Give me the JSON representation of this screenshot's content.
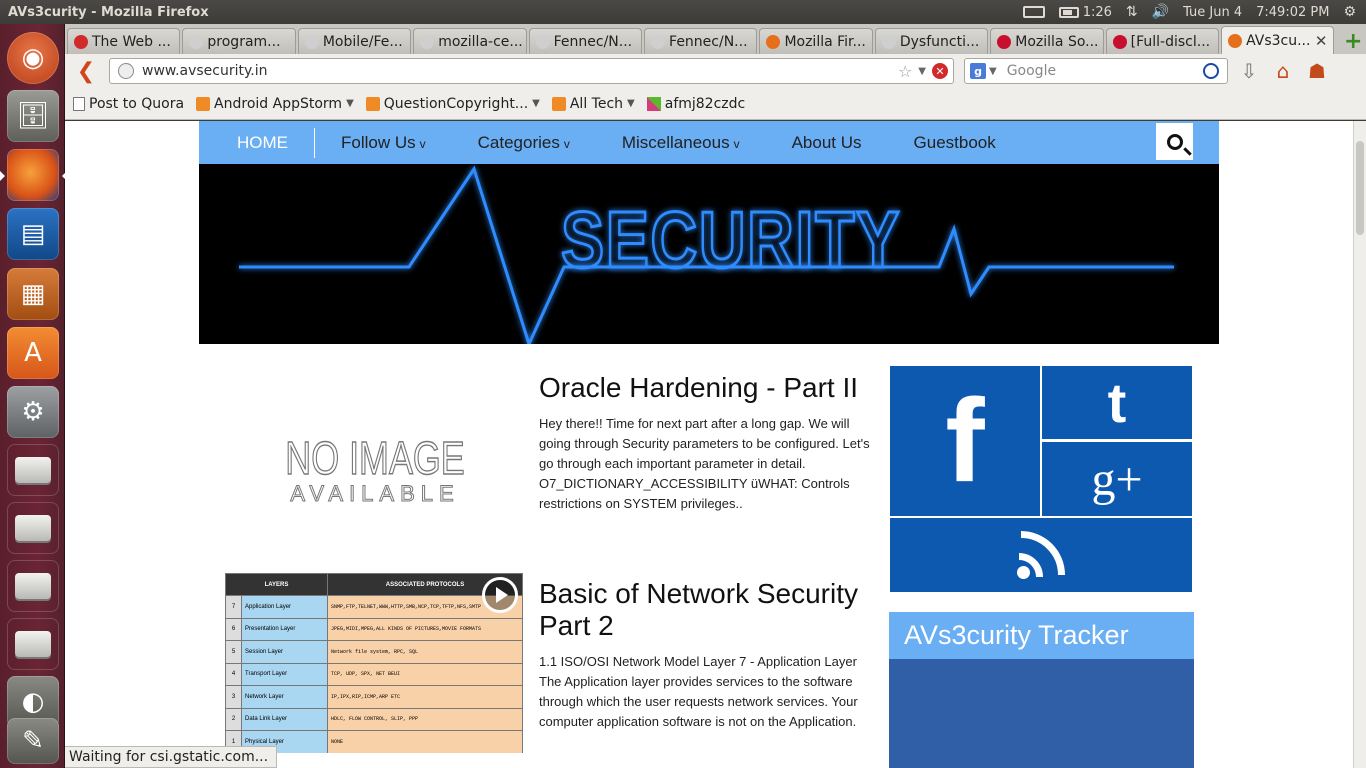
{
  "window": {
    "title": "AVs3curity - Mozilla Firefox"
  },
  "tray": {
    "time_battery": "1:26",
    "date": "Tue Jun  4",
    "clock": "7:49:02 PM"
  },
  "tabs": [
    {
      "label": "The Web ...",
      "favicon_color": "#d12a2a"
    },
    {
      "label": "program...",
      "favicon_color": "#cfcfcf"
    },
    {
      "label": "Mobile/Fe...",
      "favicon_color": "#cfcfcf"
    },
    {
      "label": "mozilla-ce...",
      "favicon_color": "#cfcfcf"
    },
    {
      "label": "Fennec/N...",
      "favicon_color": "#cfcfcf"
    },
    {
      "label": "Fennec/N...",
      "favicon_color": "#cfcfcf"
    },
    {
      "label": "Mozilla Fir...",
      "favicon_color": "#e66f1c"
    },
    {
      "label": "Dysfuncti...",
      "favicon_color": "#cfcfcf"
    },
    {
      "label": "Mozilla So...",
      "favicon_color": "#c8102e"
    },
    {
      "label": "[Full-discl...",
      "favicon_color": "#c8102e"
    },
    {
      "label": "AVs3cu...",
      "favicon_color": "#e66f1c"
    }
  ],
  "toolbar": {
    "url": "www.avsecurity.in",
    "search_placeholder": "Google",
    "search_engine_badge": "g"
  },
  "bookmarks": [
    {
      "label": "Post to Quora",
      "type": "page",
      "menu": false
    },
    {
      "label": "Android AppStorm",
      "type": "rss",
      "menu": true
    },
    {
      "label": "QuestionCopyright...",
      "type": "rss",
      "menu": true
    },
    {
      "label": "All Tech",
      "type": "rss",
      "menu": true
    },
    {
      "label": "afmj82czdc",
      "type": "multi",
      "menu": false
    }
  ],
  "site": {
    "nav": {
      "home": "HOME",
      "items": [
        {
          "label": "Follow Us",
          "dropdown": true
        },
        {
          "label": "Categories",
          "dropdown": true
        },
        {
          "label": "Miscellaneous",
          "dropdown": true
        },
        {
          "label": "About Us",
          "dropdown": false
        },
        {
          "label": "Guestbook",
          "dropdown": false
        }
      ],
      "chevron": "v"
    },
    "banner_text": "SECURITY",
    "no_image": {
      "line1": "NO IMAGE",
      "line2": "AVAILABLE"
    },
    "posts": [
      {
        "title": "Oracle Hardening - Part II",
        "excerpt": "Hey there!! Time for next part after a long gap. We will going through Security parameters to be configured. Let's go through each important parameter in detail. O7_DICTIONARY_ACCESSIBILITY üWHAT: Controls restrictions on SYSTEM privileges.."
      },
      {
        "title": "Basic of Network Security Part 2",
        "excerpt": "1.1       ISO/OSI Network Model Layer 7 - Application Layer The Application layer provides services to the software through which the user requests network services. Your computer application software is not on the Application."
      }
    ],
    "osi_table": {
      "headers": [
        "LAYERS",
        "ASSOCIATED PROTOCOLS"
      ],
      "rows": [
        {
          "n": "7",
          "layer": "Application Layer",
          "protocols": "SNMP,FTP,TELNET,WWW,HTTP,SMB,NCP,TCP,TFTP,NFS,SMTP"
        },
        {
          "n": "6",
          "layer": "Presentation Layer",
          "protocols": "JPEG,MIDI,MPEG,ALL KINDS OF PICTURES,MOVIE FORMATS"
        },
        {
          "n": "5",
          "layer": "Session Layer",
          "protocols": "Network file system, RPC, SQL"
        },
        {
          "n": "4",
          "layer": "Transport Layer",
          "protocols": "TCP, UDP, SPX, NET BEUI"
        },
        {
          "n": "3",
          "layer": "Network Layer",
          "protocols": "IP,IPX,RIP,ICMP,ARP ETC"
        },
        {
          "n": "2",
          "layer": "Data Link Layer",
          "protocols": "HDLC, FLOW CONTROL, SLIP, PPP"
        },
        {
          "n": "1",
          "layer": "Physical Layer",
          "protocols": "NONE"
        }
      ]
    },
    "social": {
      "facebook": "f",
      "twitter": "t",
      "googleplus": "g+"
    },
    "tracker_title": "AVs3curity Tracker"
  },
  "status": {
    "text": "Waiting for csi.gstatic.com..."
  },
  "colors": {
    "nav_blue": "#6aaef3",
    "social_blue": "#0d59b0",
    "tracker_blue": "#315fa7",
    "banner_glow": "#2f8cff"
  }
}
